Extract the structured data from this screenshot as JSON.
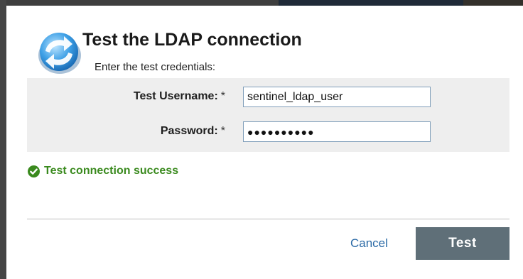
{
  "dialog": {
    "title": "Test the LDAP connection",
    "subtitle": "Enter the test credentials:",
    "icon": "refresh-arrows-icon",
    "accent_color": "#2a8fd6"
  },
  "form": {
    "username": {
      "label": "Test Username:",
      "required_marker": "*",
      "value": "sentinel_ldap_user"
    },
    "password": {
      "label": "Password:",
      "required_marker": "*",
      "masked_value": "●●●●●●●●●●"
    }
  },
  "status": {
    "icon": "check-circle-icon",
    "message": "Test connection success",
    "color": "#3a8a1e"
  },
  "actions": {
    "cancel_label": "Cancel",
    "test_label": "Test"
  }
}
